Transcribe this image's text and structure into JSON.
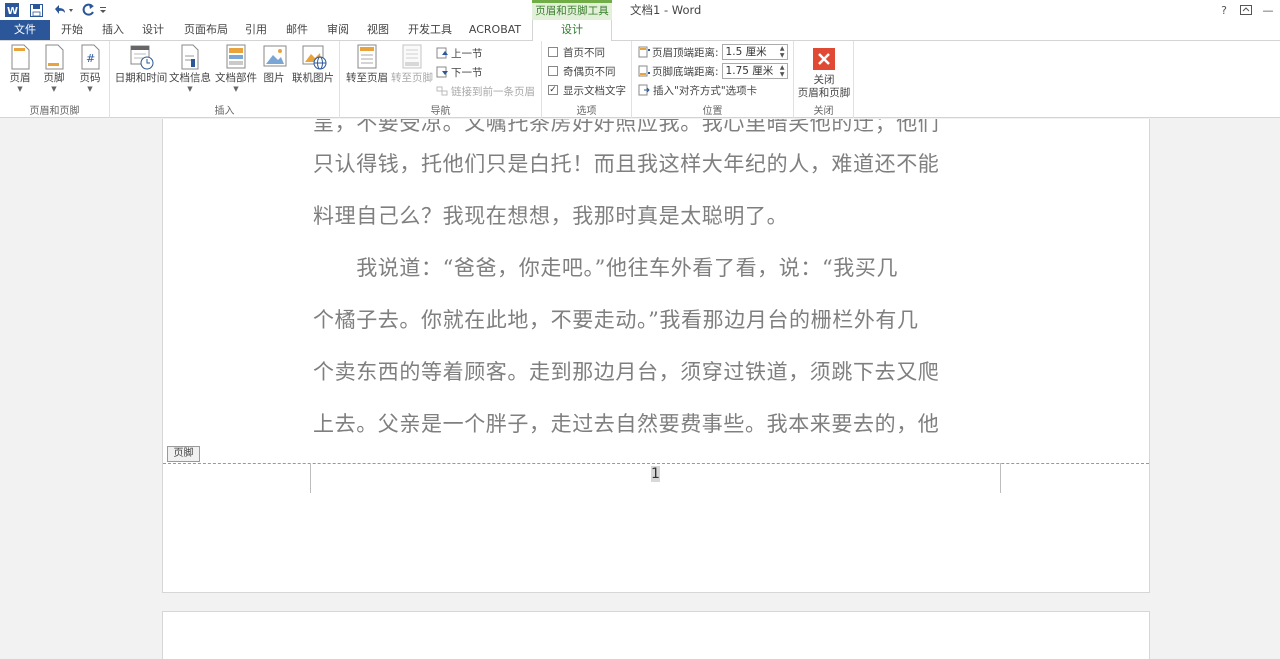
{
  "window": {
    "title": "文档1 - Word",
    "help": "?",
    "minimize": "—"
  },
  "context_group": "页眉和页脚工具",
  "tabs": [
    "文件",
    "开始",
    "插入",
    "设计",
    "页面布局",
    "引用",
    "邮件",
    "审阅",
    "视图",
    "开发工具",
    "ACROBAT",
    "设计"
  ],
  "ribbon": {
    "header_footer": {
      "label": "页眉和页脚",
      "header": "页眉",
      "footer": "页脚",
      "page_number": "页码"
    },
    "insert": {
      "label": "插入",
      "date_time": "日期和时间",
      "doc_info": "文档信息",
      "doc_parts": "文档部件",
      "picture": "图片",
      "online_picture": "联机图片"
    },
    "navigation": {
      "label": "导航",
      "goto_header": "转至页眉",
      "goto_footer": "转至页脚",
      "prev": "上一节",
      "next": "下一节",
      "link_prev": "链接到前一条页眉"
    },
    "options": {
      "label": "选项",
      "diff_first": "首页不同",
      "diff_odd_even": "奇偶页不同",
      "show_doc_text": "显示文档文字",
      "diff_first_checked": false,
      "diff_odd_even_checked": false,
      "show_doc_text_checked": true
    },
    "position": {
      "label": "位置",
      "header_top_label": "页眉顶端距离:",
      "header_top_value": "1.5 厘米",
      "footer_bottom_label": "页脚底端距离:",
      "footer_bottom_value": "1.75 厘米",
      "insert_align_tab": "插入\"对齐方式\"选项卡"
    },
    "close": {
      "label": "关闭",
      "button_line1": "关闭",
      "button_line2": "页眉和页脚"
    }
  },
  "document": {
    "lines": [
      "呈，不要受凉。又嘱托茶房好好照应我。我心里暗笑他的迂；他们",
      "只认得钱，托他们只是白托！而且我这样大年纪的人，难道还不能",
      "料理自己么？我现在想想，我那时真是太聪明了。",
      "　　我说道：“爸爸，你走吧。”他往车外看了看，说：“我买几",
      "个橘子去。你就在此地，不要走动。”我看那边月台的栅栏外有几",
      "个卖东西的等着顾客。走到那边月台，须穿过铁道，须跳下去又爬",
      "上去。父亲是一个胖子，走过去自然要费事些。我本来要去的，他"
    ],
    "footer_tag": "页脚",
    "page_number": "1"
  },
  "colors": {
    "file_tab": "#2b579a",
    "context_accent": "#70ad47",
    "close_red": "#e04a35"
  }
}
